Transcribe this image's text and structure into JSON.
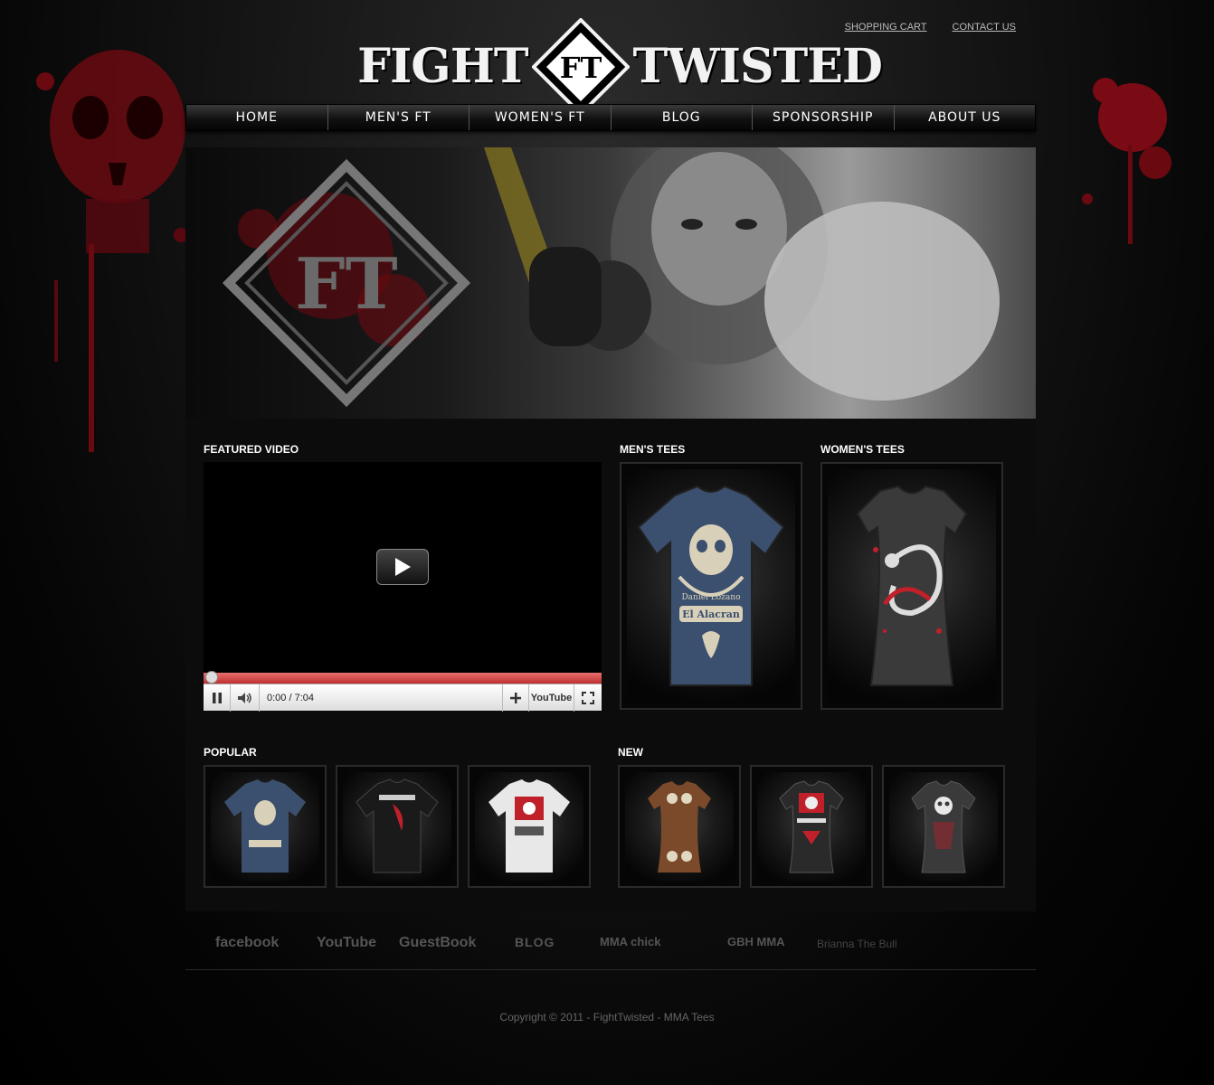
{
  "top_links": {
    "shopping_cart": "SHOPPING CART",
    "contact_us": "CONTACT US"
  },
  "logo": {
    "left_word": "FIGHT",
    "right_word": "TWISTED",
    "mark": "FT"
  },
  "nav": {
    "items": [
      {
        "label": "HOME"
      },
      {
        "label": "MEN'S FT"
      },
      {
        "label": "WOMEN'S FT"
      },
      {
        "label": "BLOG"
      },
      {
        "label": "SPONSORSHIP"
      },
      {
        "label": "ABOUT US"
      }
    ]
  },
  "hero": {
    "mark": "FT"
  },
  "featured_video": {
    "title": "FEATURED VIDEO",
    "time": "0:00 / 7:04",
    "youtube_label": "YouTube",
    "progress": 0
  },
  "mens_tees": {
    "title": "MEN'S TEES",
    "shirt_text": "El Alacran",
    "shirt_subtext": "Daniel Lozano"
  },
  "womens_tees": {
    "title": "WOMEN'S TEES"
  },
  "popular": {
    "title": "POPULAR",
    "items": [
      {
        "color": "#3b4f6e"
      },
      {
        "color": "#1a1a1a"
      },
      {
        "color": "#e8e8e8"
      }
    ]
  },
  "new": {
    "title": "NEW",
    "items": [
      {
        "color": "#7a4a2a"
      },
      {
        "color": "#2a2a2a"
      },
      {
        "color": "#3a3a3a"
      }
    ]
  },
  "social": {
    "facebook": "facebook",
    "youtube": "YouTube",
    "guestbook": "GuestBook",
    "blog": "BLOG",
    "mma_chick": "MMA chick",
    "gbh_mma": "GBH MMA",
    "brianna": "Brianna The Bull"
  },
  "footer": {
    "copyright": "Copyright © 2011 - FightTwisted - MMA Tees"
  },
  "colors": {
    "accent_red": "#b01020",
    "progress_red": "#d04040"
  }
}
